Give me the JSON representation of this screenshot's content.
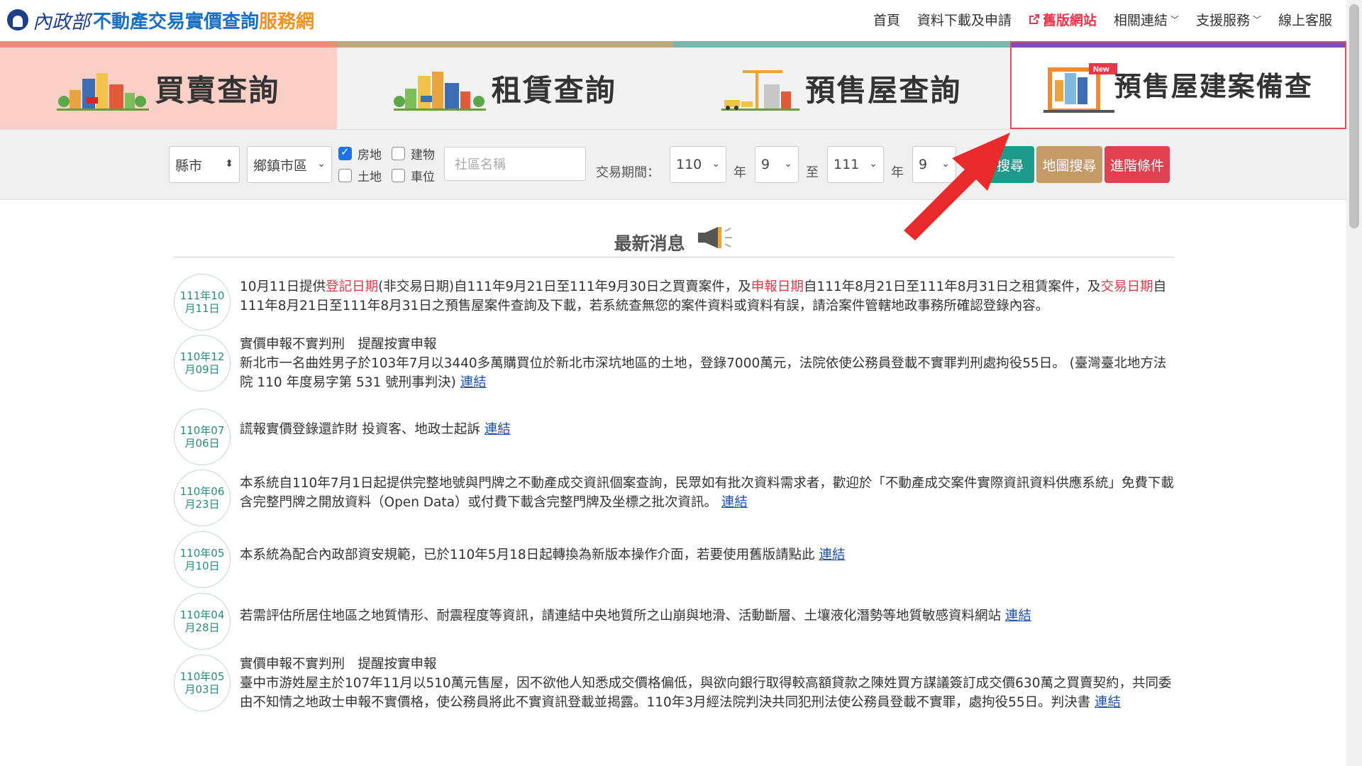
{
  "header": {
    "ministry": "內政部",
    "site_name_blue": "不動產交易實價查詢",
    "site_name_orange": "服務網",
    "nav": [
      {
        "label": "首頁"
      },
      {
        "label": "資料下載及申請"
      },
      {
        "label": "舊版網站"
      },
      {
        "label": "相關連結"
      },
      {
        "label": "支援服務"
      },
      {
        "label": "線上客服"
      }
    ]
  },
  "tiles": [
    {
      "label": "買賣查詢"
    },
    {
      "label": "租賃查詢"
    },
    {
      "label": "預售屋查詢"
    },
    {
      "label": "預售屋建案備查",
      "badge": "New"
    }
  ],
  "search": {
    "county": "縣市",
    "district": "鄉鎮市區",
    "checkboxes": [
      {
        "label": "房地",
        "checked": true
      },
      {
        "label": "建物",
        "checked": false
      },
      {
        "label": "土地",
        "checked": false
      },
      {
        "label": "車位",
        "checked": false
      }
    ],
    "community_placeholder": "社區名稱",
    "period_label": "交易期間：",
    "from_year": "110",
    "year_unit": "年",
    "from_month": "9",
    "to_label": "至",
    "to_year": "111",
    "to_month": "9",
    "search_btn": "搜尋",
    "map_btn": "地圖搜尋",
    "adv_btn": "進階條件"
  },
  "news": {
    "title": "最新消息",
    "items": [
      {
        "date_line1": "111年10",
        "date_line2": "月11日",
        "p1": "10月11日提供",
        "r1": "登記日期",
        "p2": "(非交易日期)自111年9月21日至111年9月30日之買賣案件，及",
        "r2": "申報日期",
        "p3": "自111年8月21日至111年8月31日之租賃案件，及",
        "r3": "交易日期",
        "p4": "自111年8月21日至111年8月31日之預售屋案件查詢及下載，若系統查無您的案件資料或資料有誤，請洽案件管轄地政事務所確認登錄內容。"
      },
      {
        "date_line1": "110年12",
        "date_line2": "月09日",
        "heading": "實價申報不實判刑　提醒按實申報",
        "text": "新北市一名曲姓男子於103年7月以3440多萬購買位於新北市深坑地區的土地，登錄7000萬元，法院依使公務員登載不實罪判刑處拘役55日。 (臺灣臺北地方法院 110 年度易字第 531 號刑事判決) ",
        "link": "連結"
      },
      {
        "date_line1": "110年07",
        "date_line2": "月06日",
        "text": "謊報實價登錄還詐財 投資客、地政士起訴 ",
        "link": "連結"
      },
      {
        "date_line1": "110年06",
        "date_line2": "月23日",
        "text": "本系統自110年7月1日起提供完整地號與門牌之不動產成交資訊個案查詢，民眾如有批次資料需求者，歡迎於「不動產成交案件實際資訊資料供應系統」免費下載含完整門牌之開放資料（Open Data）或付費下載含完整門牌及坐標之批次資訊。 ",
        "link": "連結"
      },
      {
        "date_line1": "110年05",
        "date_line2": "月10日",
        "text": "本系統為配合內政部資安規範，已於110年5月18日起轉換為新版本操作介面，若要使用舊版請點此 ",
        "link": "連結"
      },
      {
        "date_line1": "110年04",
        "date_line2": "月28日",
        "text": "若需評估所居住地區之地質情形、耐震程度等資訊，請連結中央地質所之山崩與地滑、活動斷層、土壤液化潛勢等地質敏感資料網站 ",
        "link": "連結"
      },
      {
        "date_line1": "110年05",
        "date_line2": "月03日",
        "heading": "實價申報不實判刑　提醒按實申報",
        "text": "臺中市游姓屋主於107年11月以510萬元售屋，因不欲他人知悉成交價格偏低，與欲向銀行取得較高額貸款之陳姓買方謀議簽訂成交價630萬之買賣契約，共同委由不知情之地政士申報不實價格，使公務員將此不實資訊登載並揭露。110年3月經法院判決共同犯刑法使公務員登載不實罪，處拘役55日。判決書 ",
        "link": "連結"
      }
    ]
  }
}
